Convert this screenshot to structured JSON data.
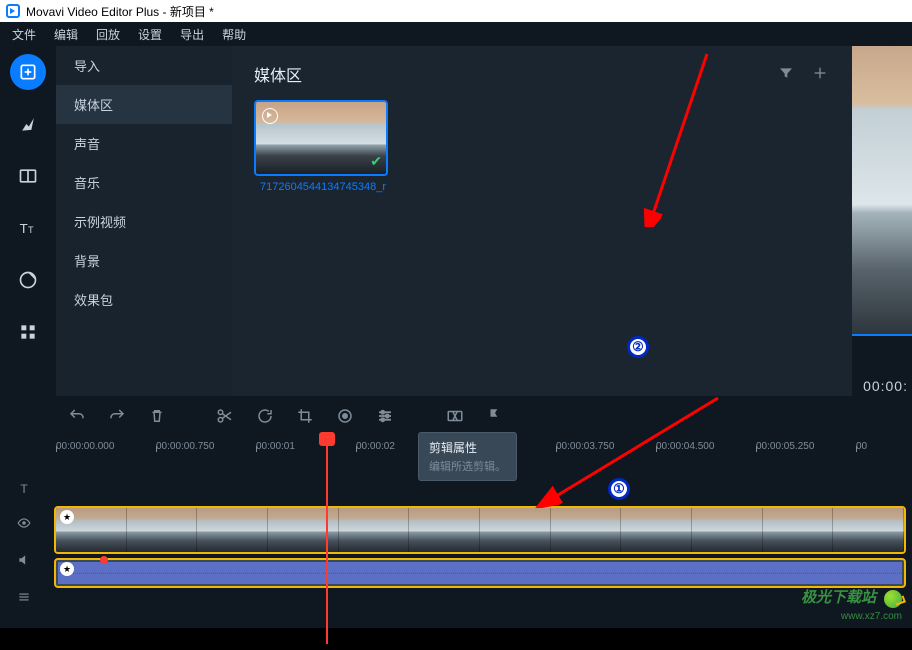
{
  "window": {
    "title": "Movavi Video Editor Plus - 新项目 *"
  },
  "menu": {
    "items": [
      "文件",
      "编辑",
      "回放",
      "设置",
      "导出",
      "帮助"
    ]
  },
  "rail": {
    "items": [
      "import",
      "fx",
      "transition",
      "text",
      "stickers",
      "more"
    ]
  },
  "sidebar": {
    "items": [
      "导入",
      "媒体区",
      "声音",
      "音乐",
      "示例视频",
      "背景",
      "效果包"
    ],
    "selected": 1
  },
  "media": {
    "title": "媒体区",
    "clip": {
      "name": "7172604544134745348_r"
    }
  },
  "preview": {
    "time": "00:00:"
  },
  "tooltip": {
    "title": "剪辑属性",
    "sub": "编辑所选剪辑。"
  },
  "ruler": {
    "marks": [
      "00:00:00.000",
      "00:00:00.750",
      "00:00:01",
      "00:00:02",
      "",
      "00:00:03.750",
      "00:00:04.500",
      "00:00:05.250",
      "00"
    ]
  },
  "annots": {
    "b1": "①",
    "b2": "②"
  },
  "watermark": {
    "l1": "极光下载站",
    "l2": "www.xz7.com"
  }
}
